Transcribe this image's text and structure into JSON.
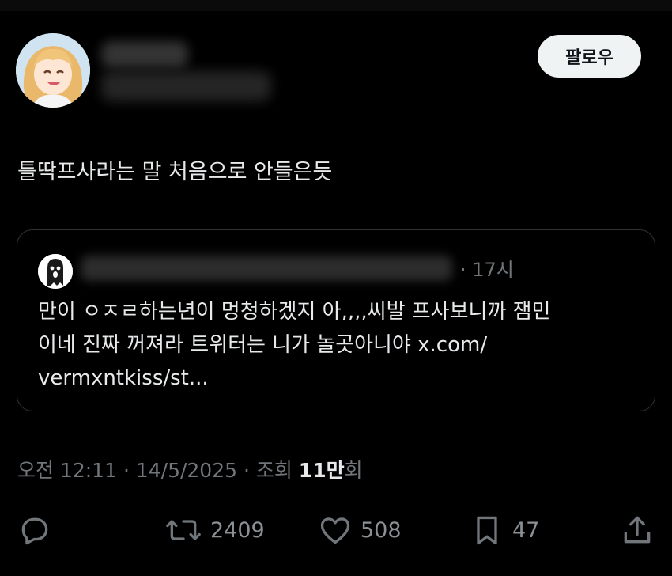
{
  "header": {
    "follow_label": "팔로우"
  },
  "tweet": {
    "text": "틀딱프사라는 말 처음으로 안들은듯",
    "quote": {
      "time": "· 17시",
      "lines": [
        "만이 ㅇㅈㄹ하는년이 멍청하겠지 아,,,,씨발 프사보니까 잼민",
        "이네 진짜 꺼져라 트위터는 니가 놀곳아니야 x.com/",
        "vermxntkiss/st..."
      ]
    },
    "meta": {
      "timestamp": "오전 12:11 · 14/5/2025 · 조회 ",
      "views_number": "11만",
      "views_suffix": "회"
    }
  },
  "actions": {
    "reply_icon": "reply-icon",
    "retweet_icon": "retweet-icon",
    "retweet_count": "2409",
    "like_icon": "heart-icon",
    "like_count": "508",
    "bookmark_icon": "bookmark-icon",
    "bookmark_count": "47",
    "share_icon": "share-icon"
  },
  "colors": {
    "background": "#000000",
    "text": "#e7e9ea",
    "muted": "#71767b",
    "button_bg": "#eff3f4"
  }
}
